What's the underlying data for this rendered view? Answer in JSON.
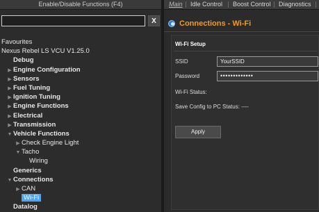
{
  "left": {
    "header": "Enable/Disable Functions (F4)",
    "clear_label": "X",
    "search_value": ""
  },
  "tree": [
    {
      "label": "Favourites",
      "bold": false,
      "indent": 0,
      "arrow": ""
    },
    {
      "label": "Nexus Rebel LS VCU V1.25.0",
      "bold": false,
      "indent": 0,
      "arrow": ""
    },
    {
      "label": "Debug",
      "bold": true,
      "indent": 1,
      "arrow": ""
    },
    {
      "label": "Engine Configuration",
      "bold": true,
      "indent": 1,
      "arrow": "collapsed"
    },
    {
      "label": "Sensors",
      "bold": true,
      "indent": 1,
      "arrow": "collapsed"
    },
    {
      "label": "Fuel Tuning",
      "bold": true,
      "indent": 1,
      "arrow": "collapsed"
    },
    {
      "label": "Ignition Tuning",
      "bold": true,
      "indent": 1,
      "arrow": "collapsed"
    },
    {
      "label": "Engine Functions",
      "bold": true,
      "indent": 1,
      "arrow": "collapsed"
    },
    {
      "label": "Electrical",
      "bold": true,
      "indent": 1,
      "arrow": "collapsed"
    },
    {
      "label": "Transmission",
      "bold": true,
      "indent": 1,
      "arrow": "collapsed"
    },
    {
      "label": "Vehicle Functions",
      "bold": true,
      "indent": 1,
      "arrow": "expanded"
    },
    {
      "label": "Check Engine Light",
      "bold": false,
      "indent": 2,
      "arrow": "collapsed"
    },
    {
      "label": "Tacho",
      "bold": false,
      "indent": 2,
      "arrow": "expanded"
    },
    {
      "label": "Wiring",
      "bold": false,
      "indent": 3,
      "arrow": ""
    },
    {
      "label": "Generics",
      "bold": true,
      "indent": 1,
      "arrow": ""
    },
    {
      "label": "Connections",
      "bold": true,
      "indent": 1,
      "arrow": "expanded"
    },
    {
      "label": "CAN",
      "bold": false,
      "indent": 2,
      "arrow": "collapsed"
    },
    {
      "label": "Wi-Fi",
      "bold": false,
      "indent": 2,
      "arrow": "",
      "selected": true
    },
    {
      "label": "Datalog",
      "bold": true,
      "indent": 1,
      "arrow": ""
    }
  ],
  "tabs": [
    {
      "label": "Main",
      "active": true
    },
    {
      "label": "Idle Control",
      "active": false
    },
    {
      "label": "Boost Control",
      "active": false
    },
    {
      "label": "Diagnostics",
      "active": false
    }
  ],
  "panel": {
    "title": "Connections - Wi-Fi",
    "section": "Wi-Fi Setup",
    "ssid_label": "SSID",
    "ssid_value": "YourSSID",
    "password_label": "Password",
    "password_value": "•••••••••••••",
    "status_label": "Wi-Fi Status:",
    "save_status_label": "Save Config to PC Status: ----",
    "apply_label": "Apply"
  },
  "colors": {
    "title": "#f39a1e",
    "selected": "#4ea5f3"
  }
}
